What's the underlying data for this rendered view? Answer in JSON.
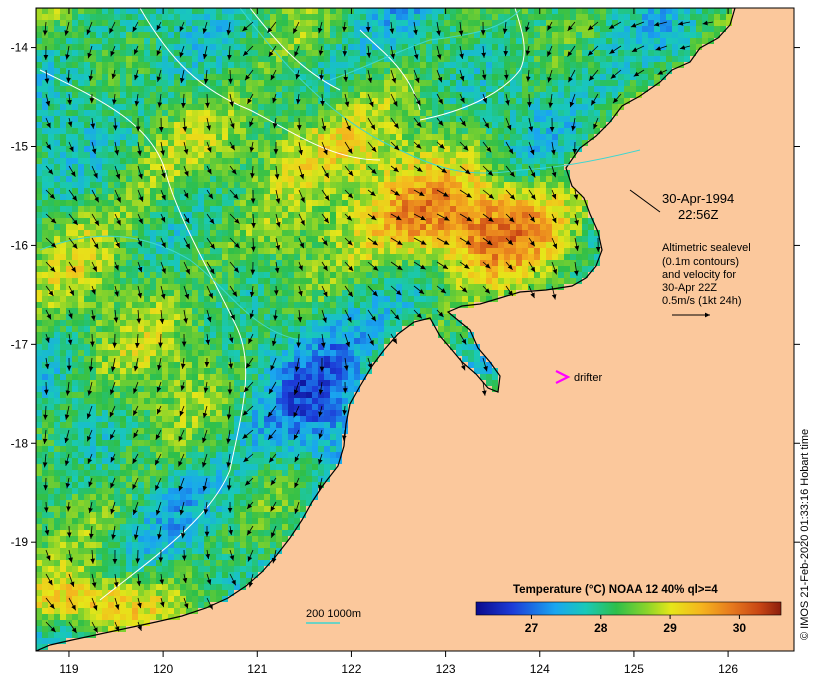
{
  "map": {
    "date": "30-Apr-1994",
    "time": "22:56Z",
    "altimetry": {
      "line1": "Altimetric sealevel",
      "line2": "(0.1m contours)",
      "line3": "and velocity for",
      "line4": "30-Apr 22Z",
      "line5": "0.5m/s (1kt 24h)"
    },
    "drifter_label": "drifter",
    "bathymetry_label": "200  1000m",
    "colorbar": {
      "title": "Temperature (°C) NOAA 12 40% ql>=4",
      "ticks": [
        "27",
        "28",
        "29",
        "30"
      ],
      "range": [
        26.2,
        30.6
      ]
    },
    "credit": "© IMOS 21-Feb-2020 01:33:16 Hobart time",
    "lon_labels": [
      "119",
      "120",
      "121",
      "122",
      "123",
      "124",
      "125",
      "126"
    ],
    "lat_labels": [
      "-14",
      "-15",
      "-16",
      "-17",
      "-18",
      "-19"
    ],
    "lon_range": [
      118.65,
      126.7
    ],
    "lat_range": [
      -20.1,
      -13.6
    ],
    "colors": {
      "land": "#fbc89c",
      "drifter": "#ff00ff",
      "coast": "#000000"
    }
  }
}
